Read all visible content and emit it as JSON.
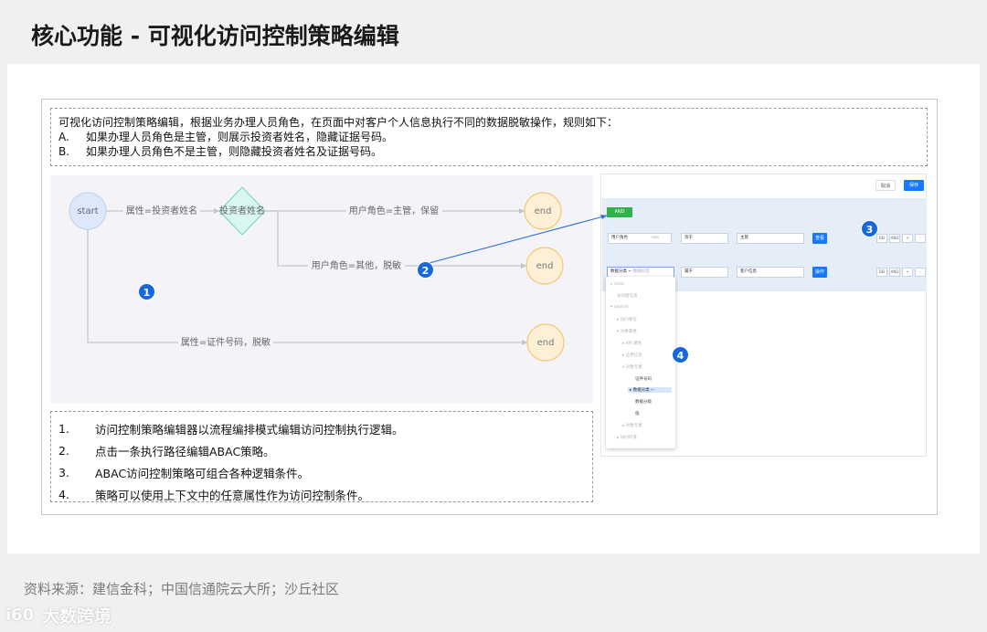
{
  "page": {
    "title": "核心功能 - 可视化访问控制策略编辑",
    "source": "资料来源：建信金科；中国信通院云大所；沙丘社区",
    "watermark": "大数跨境",
    "watermark_logo": "i60"
  },
  "rules": {
    "intro": "可视化访问控制策略编辑，根据业务办理人员角色，在页面中对客户个人信息执行不同的数据脱敏操作，规则如下：",
    "items": [
      {
        "key": "A.",
        "text": "如果办理人员角色是主管，则展示投资者姓名，隐藏证据号码。"
      },
      {
        "key": "B.",
        "text": "如果办理人员角色不是主管，则隐藏投资者姓名及证据号码。"
      }
    ]
  },
  "flow": {
    "start": "start",
    "decision": "投资者姓名",
    "end": "end",
    "edge_attr_name": "属性=投资者姓名",
    "edge_role_manager": "用户角色=主管，保留",
    "edge_role_other": "用户角色=其他，脱敏",
    "edge_attr_id": "属性=证件号码，脱敏"
  },
  "notes": [
    {
      "num": "1.",
      "text": "访问控制策略编辑器以流程编排模式编辑访问控制执行逻辑。"
    },
    {
      "num": "2.",
      "text": "点击一条执行路径编辑ABAC策略。"
    },
    {
      "num": "3.",
      "text": "ABAC访问控制策略可组合各种逻辑条件。"
    },
    {
      "num": "4.",
      "text": "策略可以使用上下文中的任意属性作为访问控制条件。"
    }
  ],
  "badges": [
    "1",
    "2",
    "3",
    "4"
  ],
  "editor": {
    "btn_cancel": "取消",
    "btn_save": "保存",
    "and_tag": "AND",
    "row1": {
      "field": "用户角色",
      "field_hint": "role",
      "op": "等于",
      "value": "主管",
      "action": "查看"
    },
    "row2": {
      "field": "数据分类",
      "field_hint": "数据标签",
      "op": "属于",
      "value": "客户信息",
      "action": "操作"
    },
    "row_controls": [
      "DEl",
      "AND",
      "+",
      "-"
    ],
    "tree": [
      "ctext",
      "访问者信息",
      "objects",
      "访问者信",
      "对象属性",
      "API 属性",
      "应用信息",
      "对象元素",
      "证件号码",
      "数据分类",
      "数据分级",
      "值",
      "对象元素",
      "访问环境"
    ]
  },
  "colors": {
    "accent": "#1668dc",
    "node_start_fill": "#dde8fa",
    "node_end_fill": "#fdf0d6",
    "node_end_stroke": "#f0c878",
    "decision_fill": "#d9f6f0",
    "decision_stroke": "#7fd8c8",
    "edge": "#c5c5c5"
  }
}
